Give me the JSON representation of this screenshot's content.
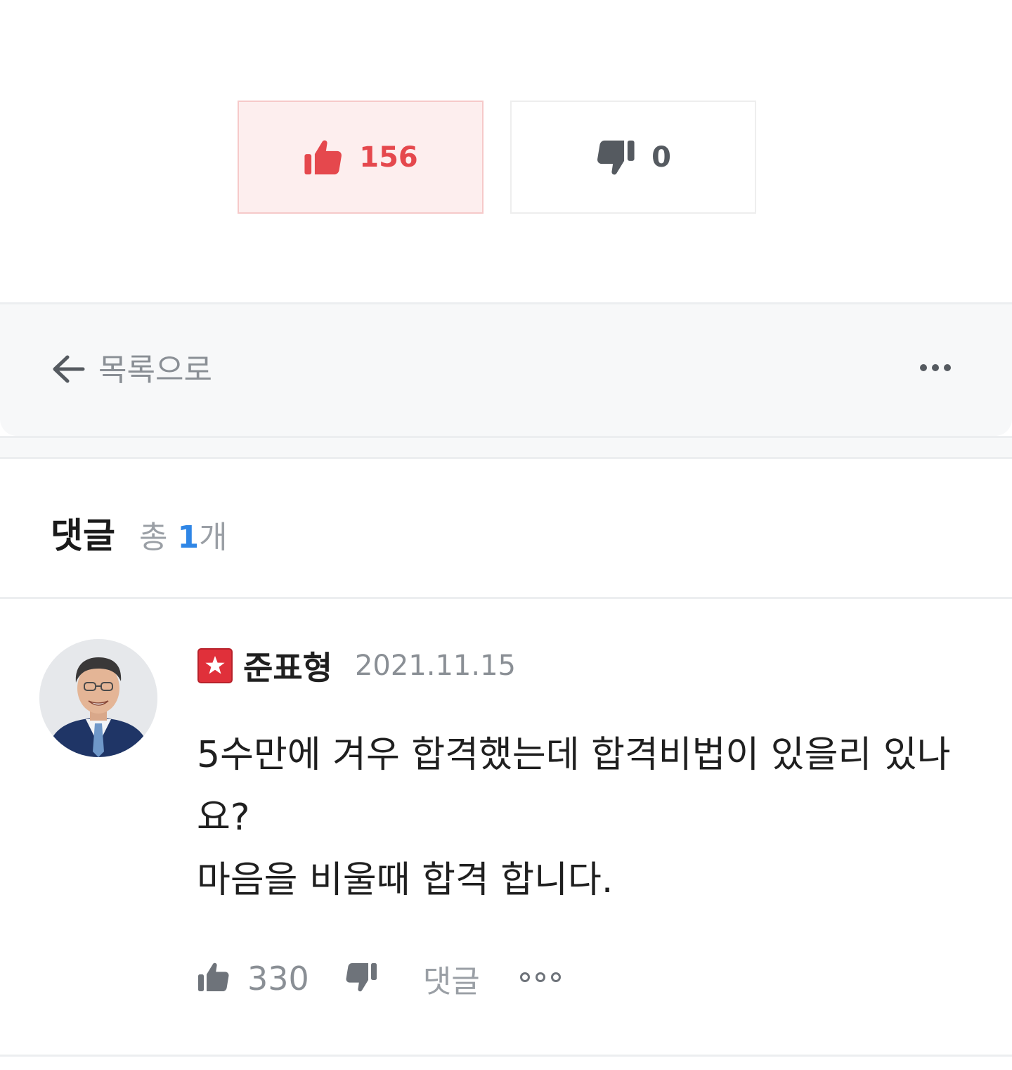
{
  "votes": {
    "up_count": "156",
    "down_count": "0"
  },
  "nav": {
    "back_label": "목록으로"
  },
  "comments": {
    "title": "댓글",
    "count_prefix": "총 ",
    "count_number": "1",
    "count_suffix": "개"
  },
  "comment": {
    "author": "준표형",
    "date": "2021.11.15",
    "body_lines": [
      "5수만에 겨우 합격했는데 합격비법이 있을리 있나요?",
      "마음을 비울때 합격 합니다."
    ],
    "like_count": "330",
    "reply_label": "댓글"
  },
  "icons": {
    "thumb_up": "thumbs-up-icon",
    "thumb_down": "thumbs-down-icon",
    "back": "arrow-left-icon",
    "more": "more-horizontal-icon",
    "badge": "star-badge-icon"
  },
  "colors": {
    "like_accent": "#e5484d",
    "count_accent": "#2f86e6",
    "badge_red": "#e0303a"
  }
}
